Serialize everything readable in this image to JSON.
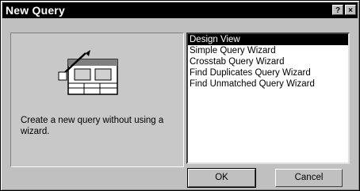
{
  "window": {
    "title": "New Query",
    "help_label": "?",
    "close_label": "×"
  },
  "description": "Create a new query without using a wizard.",
  "options": [
    {
      "label": "Design View",
      "selected": true
    },
    {
      "label": "Simple Query Wizard",
      "selected": false
    },
    {
      "label": "Crosstab Query Wizard",
      "selected": false
    },
    {
      "label": "Find Duplicates Query Wizard",
      "selected": false
    },
    {
      "label": "Find Unmatched Query Wizard",
      "selected": false
    }
  ],
  "buttons": {
    "ok": "OK",
    "cancel": "Cancel"
  }
}
